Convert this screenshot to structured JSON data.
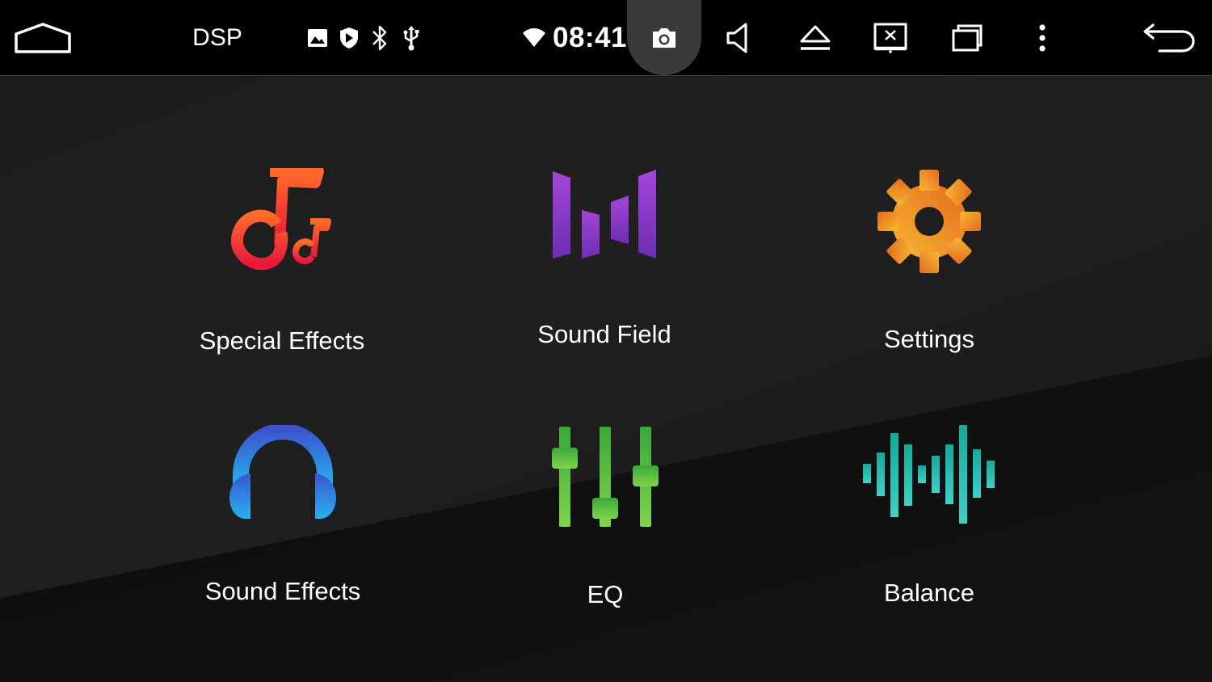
{
  "status_bar": {
    "app_title": "DSP",
    "clock": "08:41",
    "icons": [
      "home-icon",
      "gallery-icon",
      "shield-icon",
      "bluetooth-icon",
      "usb-icon",
      "wifi-icon",
      "camera-icon",
      "volume-icon",
      "eject-icon",
      "screen-off-icon",
      "recent-apps-icon",
      "more-icon",
      "back-icon"
    ]
  },
  "tiles": [
    {
      "label": "Special Effects",
      "icon": "music-notes-icon",
      "colors": [
        "#ff3b2f",
        "#e8173a"
      ]
    },
    {
      "label": "Sound Field",
      "icon": "sound-field-icon",
      "colors": [
        "#8e3fd0",
        "#6a2bb0"
      ]
    },
    {
      "label": "Settings",
      "icon": "gear-icon",
      "colors": [
        "#f6a623",
        "#e8721c"
      ]
    },
    {
      "label": "Sound Effects",
      "icon": "headphones-icon",
      "colors": [
        "#3a63d8",
        "#2aa8ea"
      ]
    },
    {
      "label": "EQ",
      "icon": "equalizer-icon",
      "colors": [
        "#6fcf3a",
        "#2f9e3c"
      ]
    },
    {
      "label": "Balance",
      "icon": "waveform-icon",
      "colors": [
        "#1fb7a8",
        "#39c9c0"
      ]
    }
  ]
}
